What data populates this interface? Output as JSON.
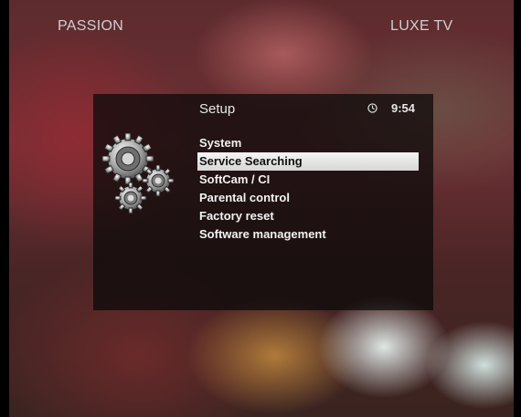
{
  "overlay": {
    "channel_left": "PASSION",
    "channel_right": "LUXE TV"
  },
  "menu": {
    "title": "Setup",
    "time": "9:54",
    "selected_index": 1,
    "items": [
      {
        "label": "System"
      },
      {
        "label": "Service Searching"
      },
      {
        "label": "SoftCam / CI"
      },
      {
        "label": "Parental control"
      },
      {
        "label": "Factory reset"
      },
      {
        "label": "Software management"
      }
    ]
  },
  "colors": {
    "panel_background": "#0b0b0b",
    "text": "#f2f2f2",
    "highlight": "#e6e6e6",
    "highlight_text": "#111111"
  },
  "icons": {
    "menu_icon": "gears-icon",
    "time_icon": "clock-icon"
  }
}
